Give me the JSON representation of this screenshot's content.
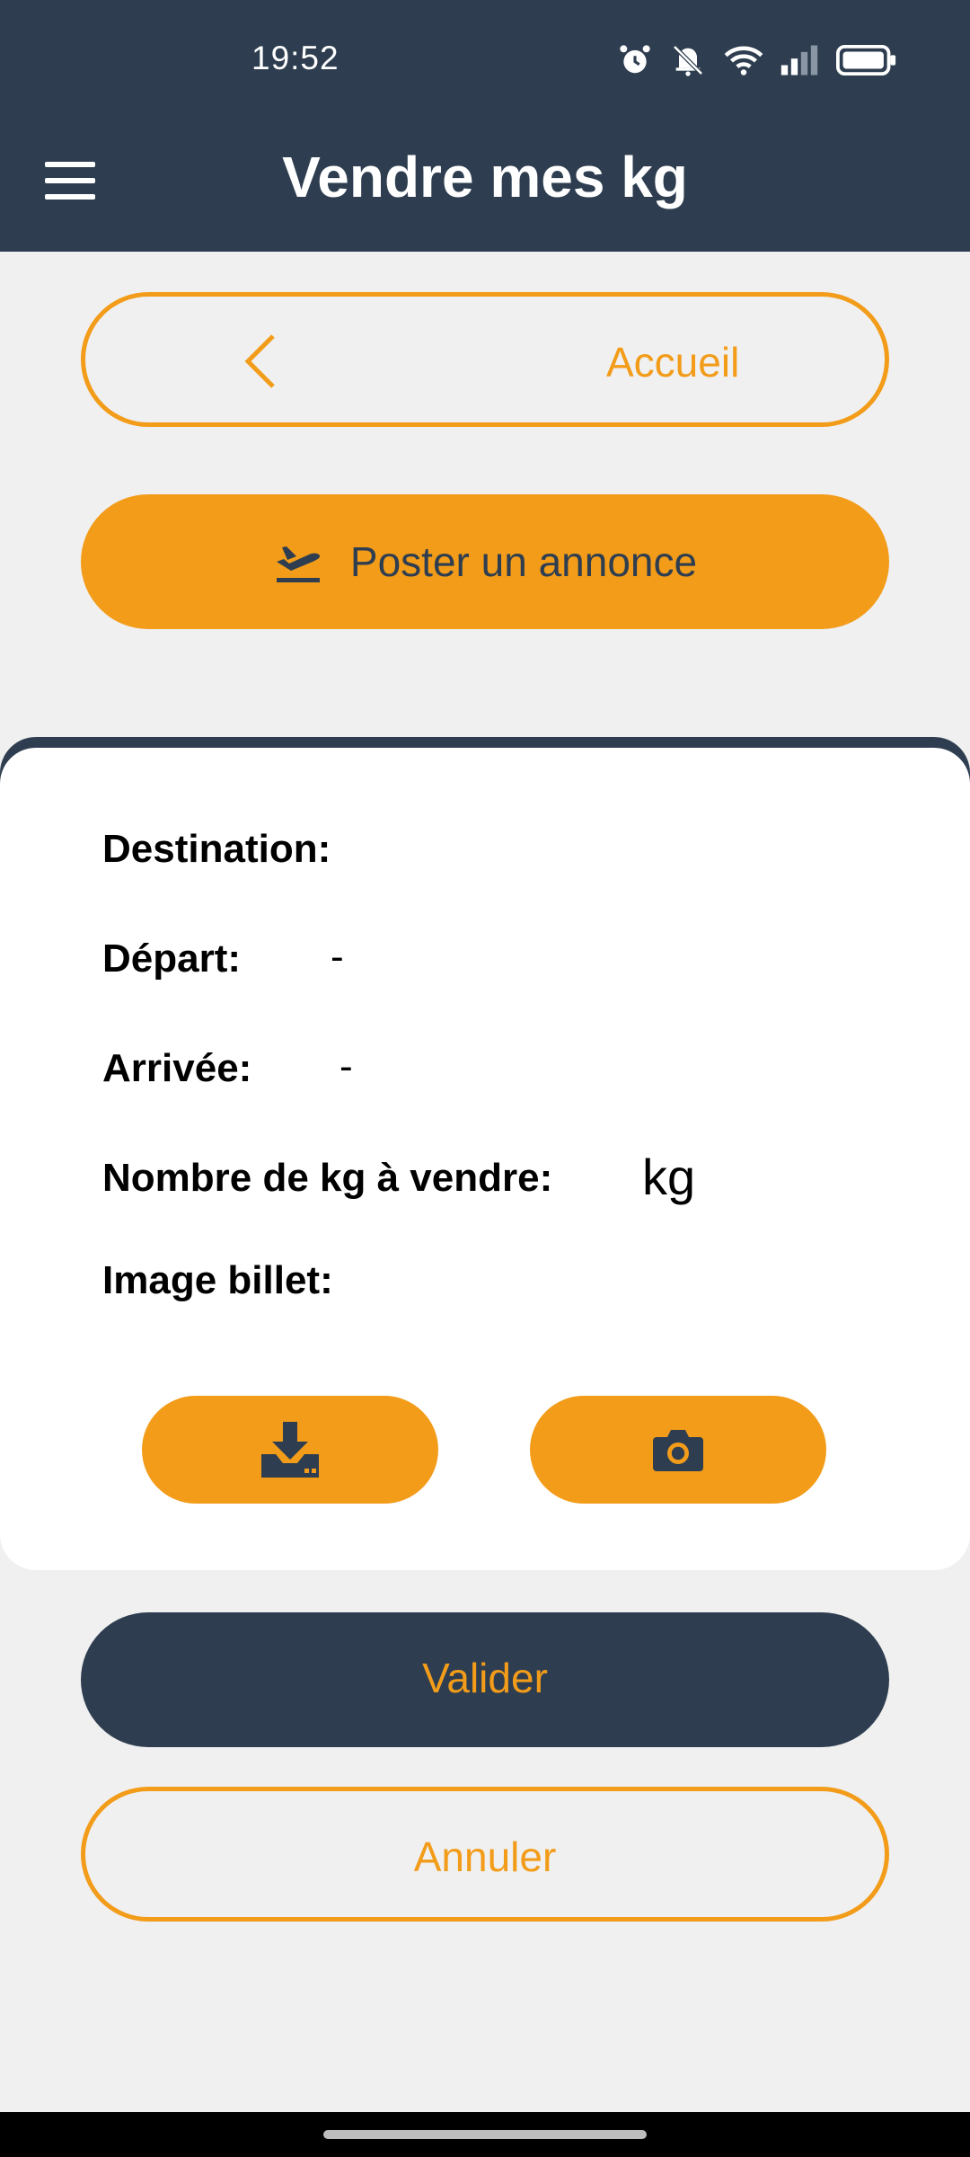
{
  "status_bar": {
    "time": "19:52",
    "icons": [
      "alarm-icon",
      "mute-icon",
      "wifi-icon",
      "signal-icon",
      "battery-icon"
    ]
  },
  "app_bar": {
    "title": "Vendre mes kg",
    "menu_icon": "hamburger-menu-icon"
  },
  "home_button": {
    "label": "Accueil",
    "icon": "chevron-left-icon"
  },
  "post_button": {
    "label": "Poster un annonce",
    "icon": "plane-departure-icon"
  },
  "form": {
    "destination_label": "Destination:",
    "destination_value": "",
    "departure_label": "Départ:",
    "departure_value": "-",
    "arrival_label": "Arrivée:",
    "arrival_value": "-",
    "kg_label": "Nombre de kg à vendre:",
    "kg_unit": "kg",
    "ticket_image_label": "Image billet:",
    "upload_icon": "download-tray-icon",
    "camera_icon": "camera-icon"
  },
  "validate_button": {
    "label": "Valider"
  },
  "cancel_button": {
    "label": "Annuler"
  },
  "colors": {
    "primary_dark": "#2e3e50",
    "accent_orange": "#f29c1a",
    "background": "#f0f0f0",
    "card": "#ffffff"
  }
}
